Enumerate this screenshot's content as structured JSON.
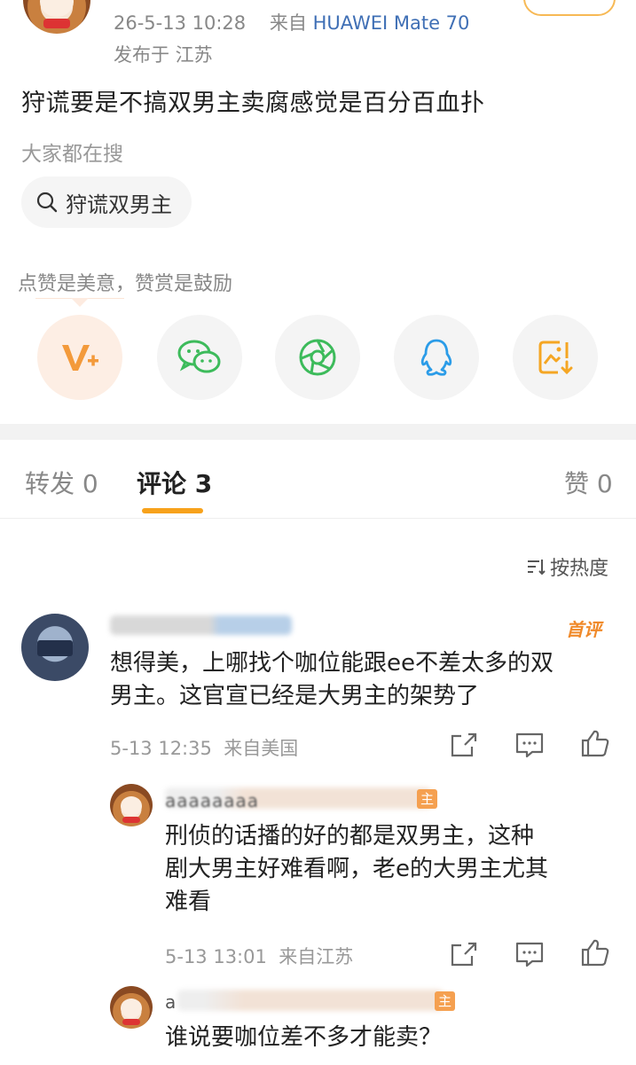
{
  "post": {
    "timestamp": "26-5-13 10:28",
    "source_prefix": "来自",
    "device": "HUAWEI Mate 70",
    "location": "发布于 江苏",
    "text": "狩谎要是不搞双男主卖腐感觉是百分百血扑",
    "everyone_searching": "大家都在搜",
    "search_chip": "狩谎双男主",
    "like_hint": "点赞是美意，赞赏是鼓励"
  },
  "share": [
    {
      "icon": "reward-v-icon"
    },
    {
      "icon": "wechat-icon"
    },
    {
      "icon": "moments-icon"
    },
    {
      "icon": "qq-icon"
    },
    {
      "icon": "save-image-icon"
    }
  ],
  "tabs": {
    "repost": "转发 0",
    "comments": "评论 3",
    "likes": "赞 0"
  },
  "sort_label": "按热度",
  "comments": [
    {
      "badge": "首评",
      "text_line1": "想得美，上哪找个咖位能跟ee不差太多的双",
      "text_line2": "男主。这官宣已经是大男主的架势了",
      "meta": "5-13 12:35  来自美国"
    }
  ],
  "replies": [
    {
      "name": "aaaaaaaa",
      "tag": "主",
      "text_line1": "刑侦的话播的好的都是双男主，这种",
      "text_line2": "剧大男主好难看啊，老e的大男主尤其",
      "text_line3": "难看",
      "meta": "5-13 13:01  来自江苏"
    },
    {
      "name": "a",
      "tag": "主",
      "text_line1": "谁说要咖位差不多才能卖？"
    }
  ],
  "colors": {
    "accent": "#f7a21b",
    "device_blue": "#3f6fb5",
    "badge_orange": "#f08a2a"
  }
}
